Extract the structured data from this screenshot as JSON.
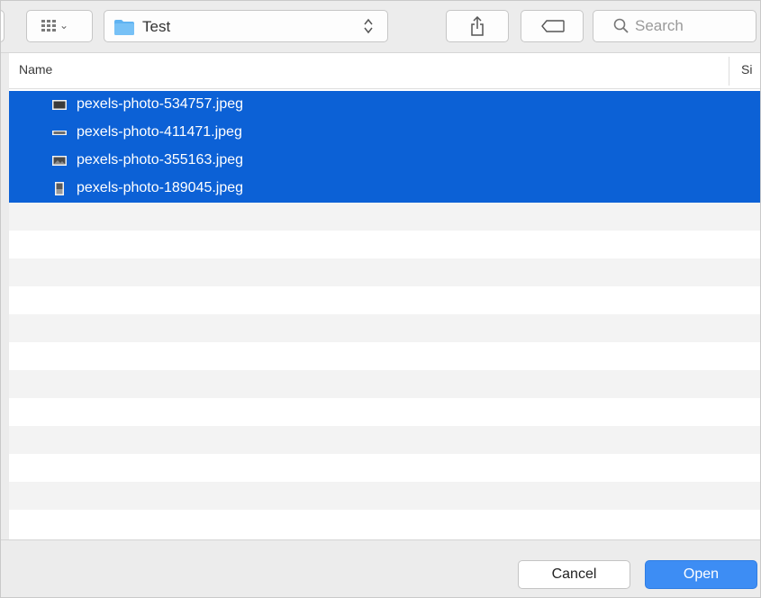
{
  "toolbar": {
    "location": "Test",
    "search_placeholder": "Search"
  },
  "list": {
    "columns": {
      "name": "Name",
      "size": "Si"
    },
    "files": [
      {
        "name": "pexels-photo-534757.jpeg",
        "selected": true,
        "icon": "landscape-image-file-icon"
      },
      {
        "name": "pexels-photo-411471.jpeg",
        "selected": true,
        "icon": "wide-image-file-icon"
      },
      {
        "name": "pexels-photo-355163.jpeg",
        "selected": true,
        "icon": "landscape-image-file-icon"
      },
      {
        "name": "pexels-photo-189045.jpeg",
        "selected": true,
        "icon": "portrait-image-file-icon"
      }
    ]
  },
  "buttons": {
    "cancel": "Cancel",
    "open": "Open"
  },
  "colors": {
    "selection": "#0c61d6",
    "accent": "#3d8df4",
    "folder": "#5fb3f2",
    "stripe": "#f3f3f3"
  }
}
